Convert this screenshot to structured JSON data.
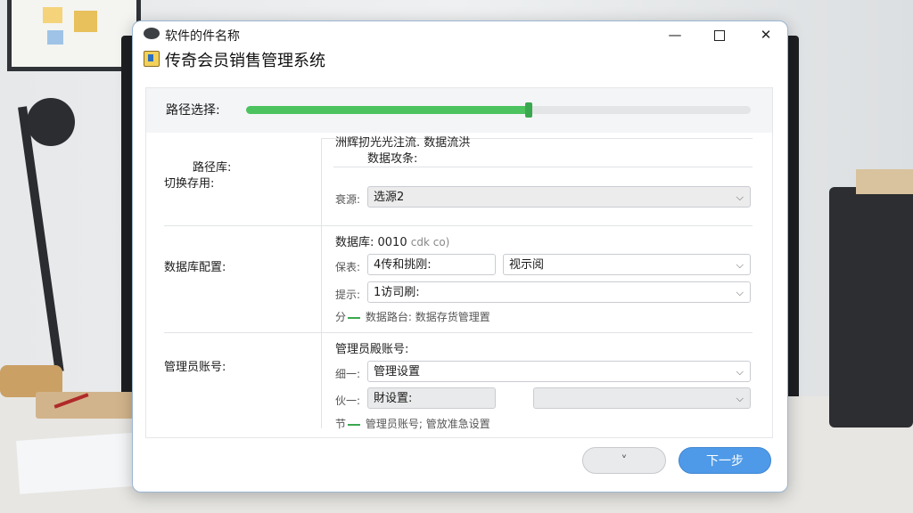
{
  "window": {
    "title": "软件的件名称",
    "subtitle": "传奇会员销售管理系统",
    "minimize": "—",
    "close": "✕"
  },
  "path": {
    "label": "路径选择:",
    "progress": 0.56
  },
  "section1": {
    "label_line1": "路径库:",
    "label_line2": "切换存用:",
    "desc_line1": "洲辉扨光光注流. 数据流洪",
    "desc_line2": "数据攻条:",
    "field_label": "衰源:",
    "select_value": "选源2"
  },
  "section2": {
    "label": "数据库配置:",
    "header": "数据库: 0010",
    "header_note": "cdk co)",
    "row1_label": "保表:",
    "row1_input": "4传和挑刚:",
    "row1_select": "视示阅",
    "row2_label": "提示:",
    "row2_select": "1访司刷:",
    "note_prefix": "分",
    "note_text": "数据路台: 数据存货管理置"
  },
  "section3": {
    "label": "管理员账号:",
    "header": "管理员殿账号:",
    "row1_label": "细一:",
    "row1_select": "管理设置",
    "row2_label": "伙一:",
    "row2_input": "財设置:",
    "note_prefix": "节",
    "note_text": "管理员账号; 管放准急设置"
  },
  "footer": {
    "back_label": "˅",
    "next_label": "下一步"
  },
  "icons": {
    "app": "app-logo-icon",
    "sub": "folder-icon",
    "chevron": "chevron-down-icon"
  }
}
